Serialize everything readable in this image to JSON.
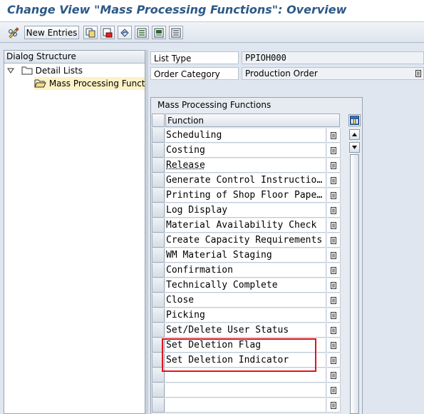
{
  "window": {
    "title": "Change View \"Mass Processing Functions\": Overview"
  },
  "toolbar": {
    "new_entries_label": "New Entries"
  },
  "dialog_structure": {
    "header": "Dialog Structure",
    "items": [
      {
        "label": "Detail Lists",
        "level": 1,
        "expanded": true
      },
      {
        "label": "Mass Processing Functions",
        "level": 2,
        "selected": true
      }
    ]
  },
  "header_fields": [
    {
      "label": "List Type",
      "value": "PPIOH000"
    },
    {
      "label": "Order Category",
      "value": "Production Order"
    }
  ],
  "table": {
    "caption": "Mass Processing Functions",
    "column_header": "Function",
    "rows": [
      "Scheduling",
      "Costing",
      "Release",
      "Generate Control Instructions",
      "Printing of Shop Floor Papers",
      "Log Display",
      "Material Availability Check",
      "Create Capacity Requirements",
      "WM Material Staging",
      "Confirmation",
      "Technically Complete",
      "Close",
      "Picking",
      "Set/Delete User Status",
      "Set Deletion Flag",
      "Set Deletion Indicator",
      "",
      "",
      ""
    ]
  },
  "colors": {
    "title": "#2c5987",
    "background": "#dfe6ef",
    "selected_node": "#fdf2c6",
    "highlight_box": "#e3141b"
  }
}
